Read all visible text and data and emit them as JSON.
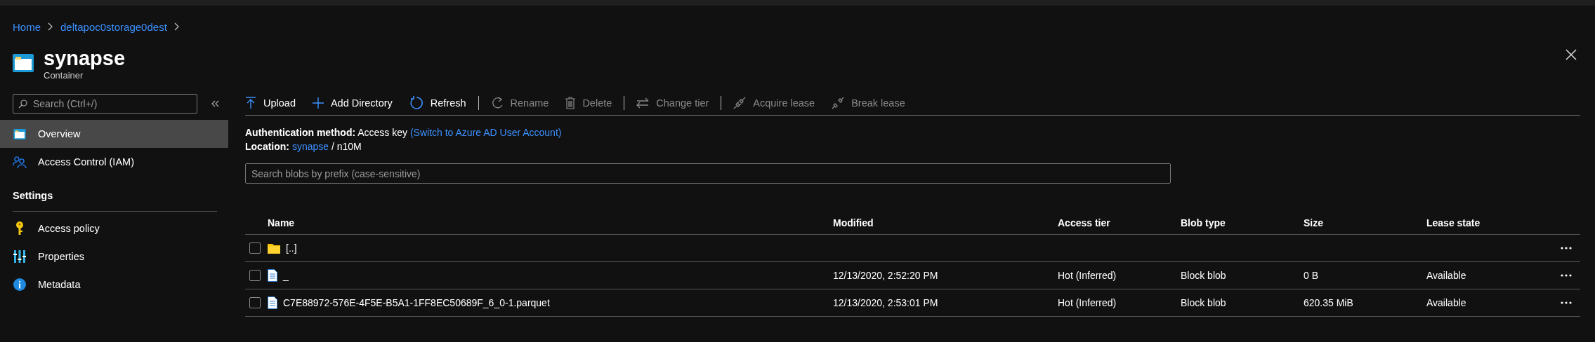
{
  "breadcrumb": [
    {
      "label": "Home"
    },
    {
      "label": "deltapoc0storage0dest"
    }
  ],
  "header": {
    "title": "synapse",
    "subtitle": "Container"
  },
  "sidebar": {
    "search": {
      "placeholder": "Search (Ctrl+/)"
    },
    "items": [
      {
        "label": "Overview",
        "selected": true
      },
      {
        "label": "Access Control (IAM)",
        "selected": false
      }
    ],
    "sections": [
      {
        "title": "Settings",
        "items": [
          {
            "label": "Access policy",
            "selected": false
          },
          {
            "label": "Properties",
            "selected": false
          },
          {
            "label": "Metadata",
            "selected": false
          }
        ]
      }
    ]
  },
  "toolbar": [
    [
      {
        "label": "Upload",
        "disabled": false
      },
      {
        "label": "Add Directory",
        "disabled": false
      },
      {
        "label": "Refresh",
        "disabled": false
      }
    ],
    [
      {
        "label": "Rename",
        "disabled": true
      },
      {
        "label": "Delete",
        "disabled": true
      }
    ],
    [
      {
        "label": "Change tier",
        "disabled": true
      }
    ],
    [
      {
        "label": "Acquire lease",
        "disabled": true
      },
      {
        "label": "Break lease",
        "disabled": true
      }
    ]
  ],
  "auth": {
    "label": "Authentication method:",
    "value": "Access key",
    "link": "(Switch to Azure AD User Account)"
  },
  "location": {
    "label": "Location:",
    "link": "synapse",
    "separator": "/",
    "path": "n10M"
  },
  "blob_search": {
    "placeholder": "Search blobs by prefix (case-sensitive)"
  },
  "table": {
    "columns": [
      "Name",
      "Modified",
      "Access tier",
      "Blob type",
      "Size",
      "Lease state"
    ],
    "rows": [
      {
        "kind": "folder",
        "checked": false,
        "cells": [
          "[..]",
          "",
          "",
          "",
          "",
          ""
        ]
      },
      {
        "kind": "file",
        "checked": false,
        "cells": [
          "_",
          "12/13/2020, 2:52:20 PM",
          "Hot (Inferred)",
          "Block blob",
          "0 B",
          "Available"
        ]
      },
      {
        "kind": "file",
        "checked": false,
        "cells": [
          "C7E88972-576E-4F5E-B5A1-1FF8EC50689F_6_0-1.parquet",
          "12/13/2020, 2:53:01 PM",
          "Hot (Inferred)",
          "Block blob",
          "620.35 MiB",
          "Available"
        ]
      }
    ]
  }
}
